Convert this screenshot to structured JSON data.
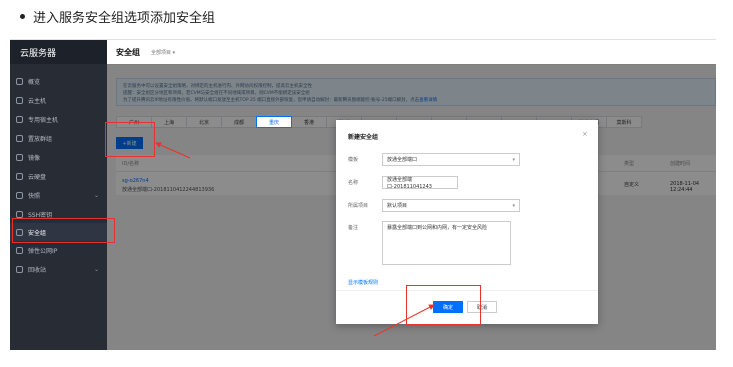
{
  "heading": {
    "text": "进入服务安全组选项添加安全组"
  },
  "sidebar": {
    "title": "云服务器",
    "items": [
      {
        "label": "概览"
      },
      {
        "label": "云主机"
      },
      {
        "label": "专用宿主机"
      },
      {
        "label": "置放群组"
      },
      {
        "label": "镜像"
      },
      {
        "label": "云硬盘"
      },
      {
        "label": "快照"
      },
      {
        "label": "SSH密钥"
      },
      {
        "label": "安全组"
      },
      {
        "label": "弹性公网IP"
      },
      {
        "label": "回收站"
      }
    ]
  },
  "topbar": {
    "title": "安全组",
    "project": "全部项目 ▾"
  },
  "tip": {
    "line1": "在云服务中可以设置安全组策略，对绑定的主机进行内、外网访问权限控制，提高云主机安全性",
    "line2": "提醒：安全组区分地区和项目，若CVM与安全组在不同地域或项目，则CVM不能绑定该安全组",
    "line3": "为了提升腾讯云IP地址有限性价值，将默认端口发放至主机TOP 25 端口直接外部恢复，您申请自动解封：最新腾讯图端能控-账号-25端口解封，点击",
    "link": "查看详情"
  },
  "regions": [
    "广州",
    "上海",
    "北京",
    "成都",
    "重庆",
    "香港",
    "新加坡",
    "",
    "",
    "",
    "",
    "",
    "",
    "法兰克福",
    "莫斯科"
  ],
  "new_button": "+新建",
  "table": {
    "headers": {
      "name": "ID/名称",
      "col_b": "类型",
      "col_c": "创建时间"
    },
    "row": {
      "id": "sg-o267n4",
      "name": "放通全部端口-2018110412244813936",
      "type": "自定义",
      "time": "2018-11-04 12:24:44"
    }
  },
  "modal": {
    "title": "新建安全组",
    "close": "×",
    "template_label": "模板",
    "template_value": "放通全部端口",
    "name_label": "名称",
    "name_value": "放通全部端口-201811041243",
    "project_label": "所属项目",
    "project_value": "默认项目",
    "remark_label": "备注",
    "remark_value": "暴露全部端口到公网和内网，有一定安全风险",
    "rules_link": "显示模板规则",
    "ok_button": "确定",
    "cancel_button": "取消"
  },
  "colors": {
    "accent": "#006eff",
    "highlight": "#e8332c",
    "sidebar": "#272c35"
  }
}
